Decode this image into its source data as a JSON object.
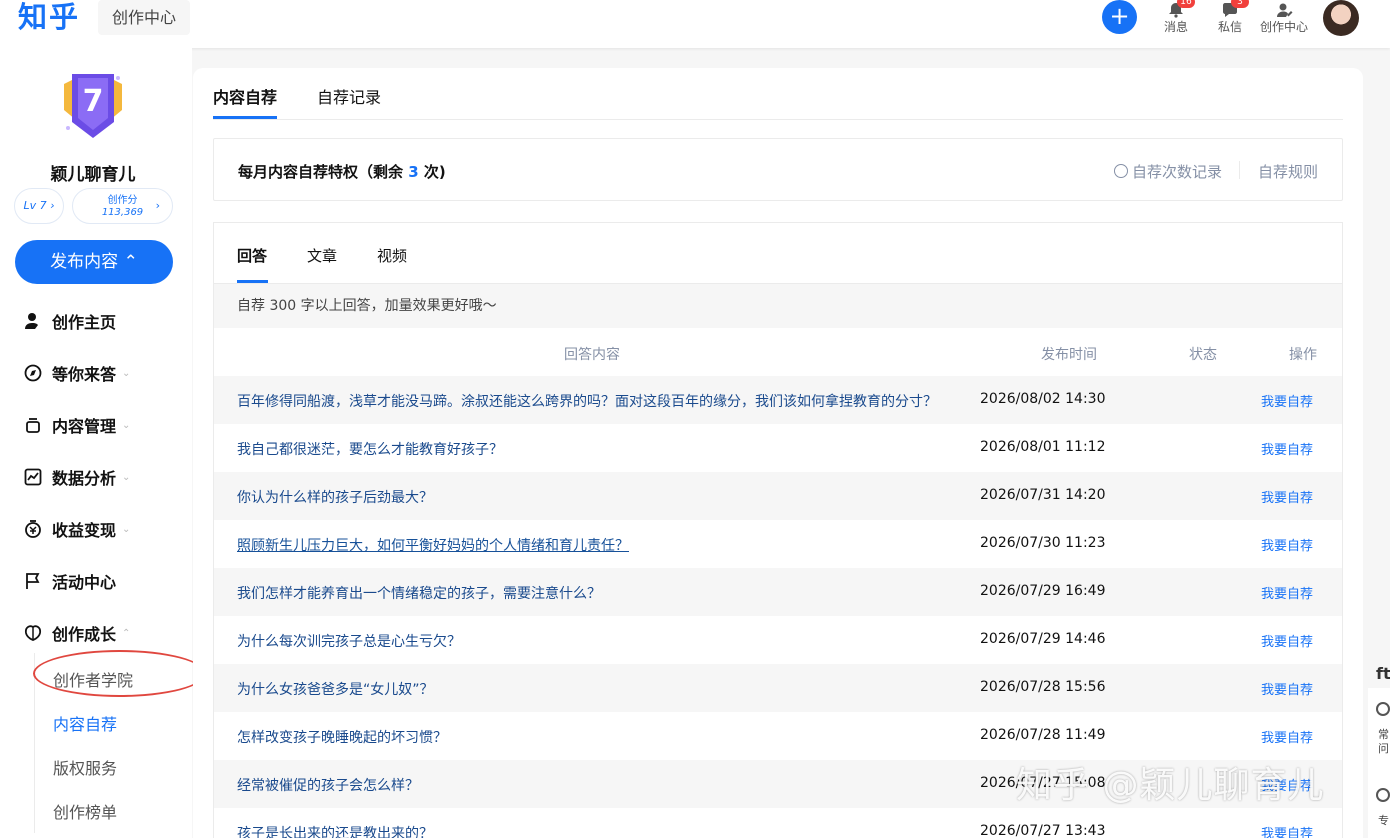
{
  "header": {
    "logo": "知乎",
    "section_tag": "创作中心",
    "plus": "+",
    "items": [
      {
        "label": "消息",
        "icon": "bell-icon",
        "badge": "16"
      },
      {
        "label": "私信",
        "icon": "message-icon",
        "badge": "3"
      },
      {
        "label": "创作中心",
        "icon": "creator-icon"
      }
    ]
  },
  "profile": {
    "level_number": "7",
    "name": "颖儿聊育儿",
    "lv_chip": "Lv 7 ›",
    "score_label": "创作分",
    "score_value": "113,369",
    "score_arrow": "›"
  },
  "publish_button": "发布内容 ⌃",
  "nav": [
    {
      "label": "创作主页",
      "icon": "person-icon",
      "chevron": ""
    },
    {
      "label": "等你来答",
      "icon": "compass-icon",
      "chevron": "⌄"
    },
    {
      "label": "内容管理",
      "icon": "layers-icon",
      "chevron": "⌄"
    },
    {
      "label": "数据分析",
      "icon": "chart-icon",
      "chevron": "⌄"
    },
    {
      "label": "收益变现",
      "icon": "money-icon",
      "chevron": "⌄"
    },
    {
      "label": "活动中心",
      "icon": "flag-icon",
      "chevron": ""
    },
    {
      "label": "创作成长",
      "icon": "leaf-icon",
      "chevron": "⌃"
    }
  ],
  "sub_nav": [
    {
      "label": "创作者学院",
      "active": false
    },
    {
      "label": "内容自荐",
      "active": true
    },
    {
      "label": "版权服务",
      "active": false
    },
    {
      "label": "创作榜单",
      "active": false
    }
  ],
  "tabs": [
    {
      "label": "内容自荐",
      "active": true
    },
    {
      "label": "自荐记录",
      "active": false
    }
  ],
  "privilege": {
    "title_prefix": "每月内容自荐特权（剩余 ",
    "remaining": "3",
    "title_suffix": " 次)",
    "record_link": "自荐次数记录",
    "rules_link": "自荐规则"
  },
  "content_tabs": [
    {
      "label": "回答",
      "active": true
    },
    {
      "label": "文章",
      "active": false
    },
    {
      "label": "视频",
      "active": false
    }
  ],
  "hint": "自荐 300 字以上回答，加量效果更好哦～",
  "table": {
    "headers": {
      "content": "回答内容",
      "time": "发布时间",
      "status": "状态",
      "action": "操作"
    },
    "rows": [
      {
        "question": "百年修得同船渡，浅草才能没马蹄。涂叔还能这么跨界的吗？面对这段百年的缘分，我们该如何拿捏教育的分寸？",
        "time": "2026/08/02 14:30",
        "action": "我要自荐"
      },
      {
        "question": "我自己都很迷茫，要怎么才能教育好孩子？",
        "time": "2026/08/01 11:12",
        "action": "我要自荐"
      },
      {
        "question": "你认为什么样的孩子后劲最大？",
        "time": "2026/07/31 14:20",
        "action": "我要自荐"
      },
      {
        "question": "照顾新生儿压力巨大，如何平衡好妈妈的个人情绪和育儿责任？",
        "time": "2026/07/30 11:23",
        "action": "我要自荐"
      },
      {
        "question": "我们怎样才能养育出一个情绪稳定的孩子，需要注意什么？",
        "time": "2026/07/29 16:49",
        "action": "我要自荐"
      },
      {
        "question": "为什么每次训完孩子总是心生亏欠？",
        "time": "2026/07/29 14:46",
        "action": "我要自荐"
      },
      {
        "question": "为什么女孩爸爸多是“女儿奴”？",
        "time": "2026/07/28 15:56",
        "action": "我要自荐"
      },
      {
        "question": "怎样改变孩子晚睡晚起的坏习惯？",
        "time": "2026/07/28 11:49",
        "action": "我要自荐"
      },
      {
        "question": "经常被催促的孩子会怎么样？",
        "time": "2026/07/27 15:08",
        "action": "我要自荐"
      },
      {
        "question": "孩子是长出来的还是教出来的？",
        "time": "2026/07/27 13:43",
        "action": "我要自荐"
      }
    ]
  },
  "float_panel": {
    "top_glyph": "ft",
    "item1": "常问",
    "item2": "专"
  },
  "watermark": "知乎 @颖儿聊育儿",
  "colors": {
    "brand": "#1772f6",
    "badge": "#f1403c",
    "annotation_circle": "#e0473f"
  }
}
